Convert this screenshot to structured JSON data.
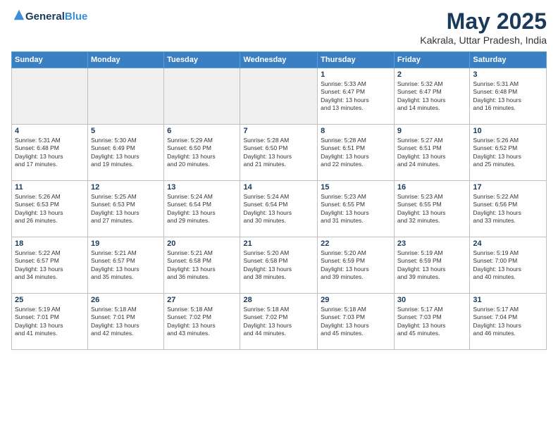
{
  "header": {
    "logo_line1": "General",
    "logo_line2": "Blue",
    "month": "May 2025",
    "location": "Kakrala, Uttar Pradesh, India"
  },
  "weekdays": [
    "Sunday",
    "Monday",
    "Tuesday",
    "Wednesday",
    "Thursday",
    "Friday",
    "Saturday"
  ],
  "weeks": [
    [
      {
        "day": "",
        "info": ""
      },
      {
        "day": "",
        "info": ""
      },
      {
        "day": "",
        "info": ""
      },
      {
        "day": "",
        "info": ""
      },
      {
        "day": "1",
        "info": "Sunrise: 5:33 AM\nSunset: 6:47 PM\nDaylight: 13 hours\nand 13 minutes."
      },
      {
        "day": "2",
        "info": "Sunrise: 5:32 AM\nSunset: 6:47 PM\nDaylight: 13 hours\nand 14 minutes."
      },
      {
        "day": "3",
        "info": "Sunrise: 5:31 AM\nSunset: 6:48 PM\nDaylight: 13 hours\nand 16 minutes."
      }
    ],
    [
      {
        "day": "4",
        "info": "Sunrise: 5:31 AM\nSunset: 6:48 PM\nDaylight: 13 hours\nand 17 minutes."
      },
      {
        "day": "5",
        "info": "Sunrise: 5:30 AM\nSunset: 6:49 PM\nDaylight: 13 hours\nand 19 minutes."
      },
      {
        "day": "6",
        "info": "Sunrise: 5:29 AM\nSunset: 6:50 PM\nDaylight: 13 hours\nand 20 minutes."
      },
      {
        "day": "7",
        "info": "Sunrise: 5:28 AM\nSunset: 6:50 PM\nDaylight: 13 hours\nand 21 minutes."
      },
      {
        "day": "8",
        "info": "Sunrise: 5:28 AM\nSunset: 6:51 PM\nDaylight: 13 hours\nand 22 minutes."
      },
      {
        "day": "9",
        "info": "Sunrise: 5:27 AM\nSunset: 6:51 PM\nDaylight: 13 hours\nand 24 minutes."
      },
      {
        "day": "10",
        "info": "Sunrise: 5:26 AM\nSunset: 6:52 PM\nDaylight: 13 hours\nand 25 minutes."
      }
    ],
    [
      {
        "day": "11",
        "info": "Sunrise: 5:26 AM\nSunset: 6:53 PM\nDaylight: 13 hours\nand 26 minutes."
      },
      {
        "day": "12",
        "info": "Sunrise: 5:25 AM\nSunset: 6:53 PM\nDaylight: 13 hours\nand 27 minutes."
      },
      {
        "day": "13",
        "info": "Sunrise: 5:24 AM\nSunset: 6:54 PM\nDaylight: 13 hours\nand 29 minutes."
      },
      {
        "day": "14",
        "info": "Sunrise: 5:24 AM\nSunset: 6:54 PM\nDaylight: 13 hours\nand 30 minutes."
      },
      {
        "day": "15",
        "info": "Sunrise: 5:23 AM\nSunset: 6:55 PM\nDaylight: 13 hours\nand 31 minutes."
      },
      {
        "day": "16",
        "info": "Sunrise: 5:23 AM\nSunset: 6:55 PM\nDaylight: 13 hours\nand 32 minutes."
      },
      {
        "day": "17",
        "info": "Sunrise: 5:22 AM\nSunset: 6:56 PM\nDaylight: 13 hours\nand 33 minutes."
      }
    ],
    [
      {
        "day": "18",
        "info": "Sunrise: 5:22 AM\nSunset: 6:57 PM\nDaylight: 13 hours\nand 34 minutes."
      },
      {
        "day": "19",
        "info": "Sunrise: 5:21 AM\nSunset: 6:57 PM\nDaylight: 13 hours\nand 35 minutes."
      },
      {
        "day": "20",
        "info": "Sunrise: 5:21 AM\nSunset: 6:58 PM\nDaylight: 13 hours\nand 36 minutes."
      },
      {
        "day": "21",
        "info": "Sunrise: 5:20 AM\nSunset: 6:58 PM\nDaylight: 13 hours\nand 38 minutes."
      },
      {
        "day": "22",
        "info": "Sunrise: 5:20 AM\nSunset: 6:59 PM\nDaylight: 13 hours\nand 39 minutes."
      },
      {
        "day": "23",
        "info": "Sunrise: 5:19 AM\nSunset: 6:59 PM\nDaylight: 13 hours\nand 39 minutes."
      },
      {
        "day": "24",
        "info": "Sunrise: 5:19 AM\nSunset: 7:00 PM\nDaylight: 13 hours\nand 40 minutes."
      }
    ],
    [
      {
        "day": "25",
        "info": "Sunrise: 5:19 AM\nSunset: 7:01 PM\nDaylight: 13 hours\nand 41 minutes."
      },
      {
        "day": "26",
        "info": "Sunrise: 5:18 AM\nSunset: 7:01 PM\nDaylight: 13 hours\nand 42 minutes."
      },
      {
        "day": "27",
        "info": "Sunrise: 5:18 AM\nSunset: 7:02 PM\nDaylight: 13 hours\nand 43 minutes."
      },
      {
        "day": "28",
        "info": "Sunrise: 5:18 AM\nSunset: 7:02 PM\nDaylight: 13 hours\nand 44 minutes."
      },
      {
        "day": "29",
        "info": "Sunrise: 5:18 AM\nSunset: 7:03 PM\nDaylight: 13 hours\nand 45 minutes."
      },
      {
        "day": "30",
        "info": "Sunrise: 5:17 AM\nSunset: 7:03 PM\nDaylight: 13 hours\nand 45 minutes."
      },
      {
        "day": "31",
        "info": "Sunrise: 5:17 AM\nSunset: 7:04 PM\nDaylight: 13 hours\nand 46 minutes."
      }
    ]
  ]
}
